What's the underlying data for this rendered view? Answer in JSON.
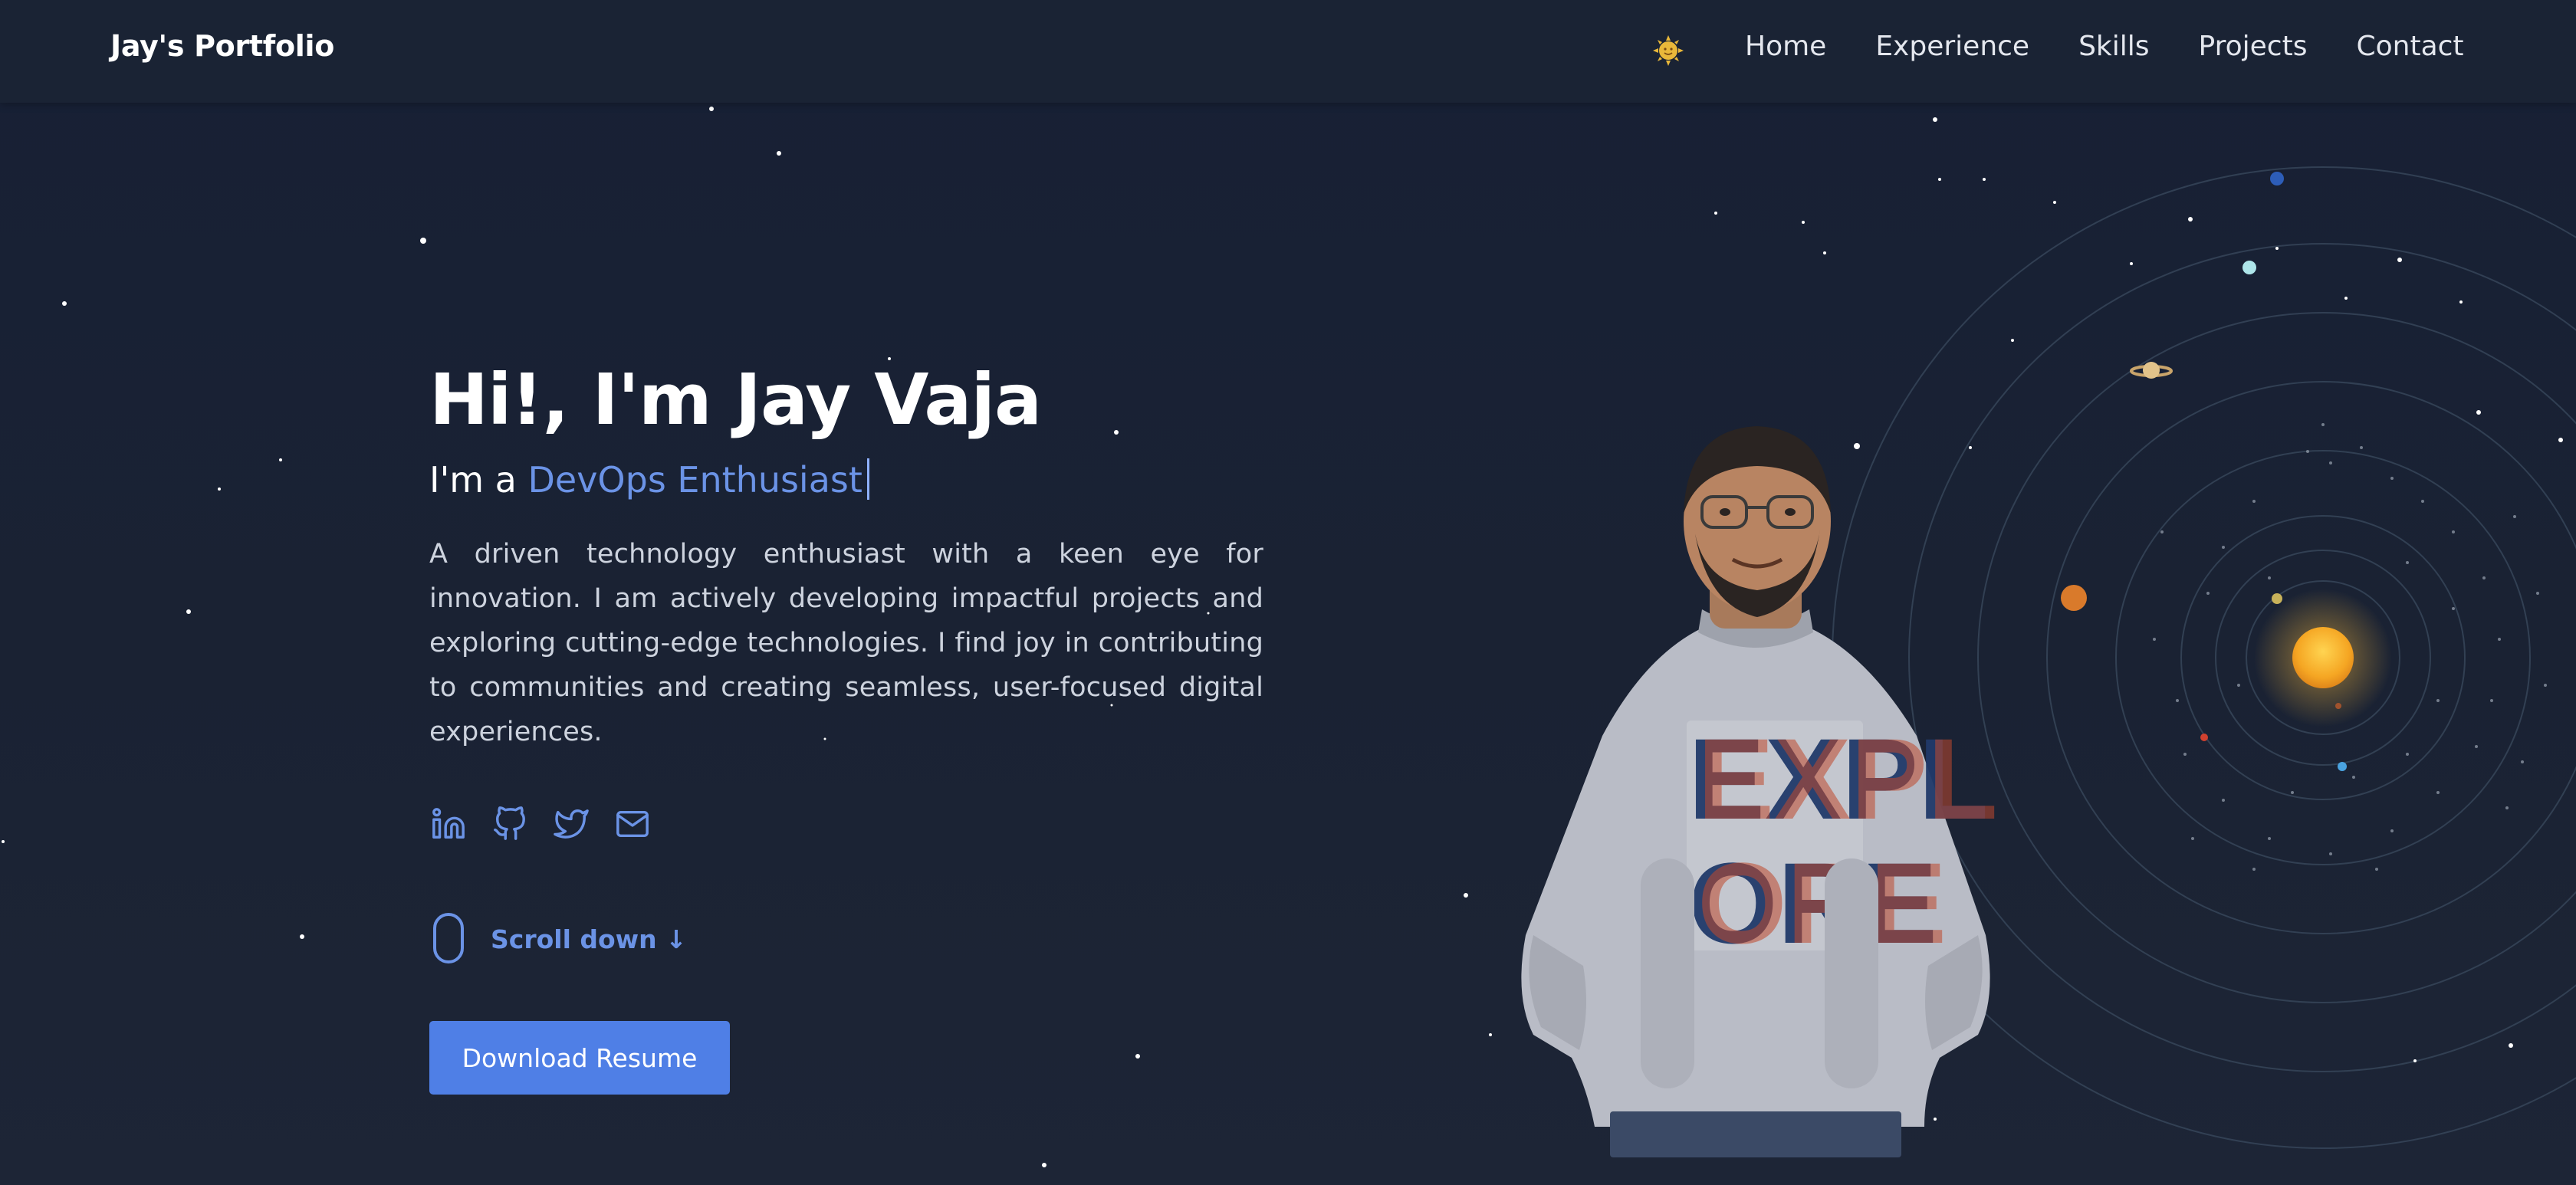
{
  "nav": {
    "brand": "Jay's Portfolio",
    "links": [
      "Home",
      "Experience",
      "Skills",
      "Projects",
      "Contact"
    ]
  },
  "theme_toggle_icon": "sun-face-icon",
  "hero": {
    "title": "Hi!, I'm Jay Vaja",
    "subtitle_prefix": "I'm a ",
    "subtitle_role": "DevOps Enthusiast",
    "bio": "A driven technology enthusiast with a keen eye for innovation. I am actively developing impactful projects and exploring cutting-edge technologies. I find joy in contributing to communities and creating seamless, user-focused digital experiences.",
    "social_icons": [
      "linkedin-icon",
      "github-icon",
      "twitter-icon",
      "mail-icon"
    ],
    "scroll_label": "Scroll down ↓",
    "resume_button": "Download Resume"
  },
  "colors": {
    "accent": "#6b93e6",
    "button": "#4f7fe6",
    "background": "#1a2233",
    "navbar": "#1b2334",
    "sun": "#f5a623"
  },
  "portrait_shirt_text": "EXPLORE"
}
